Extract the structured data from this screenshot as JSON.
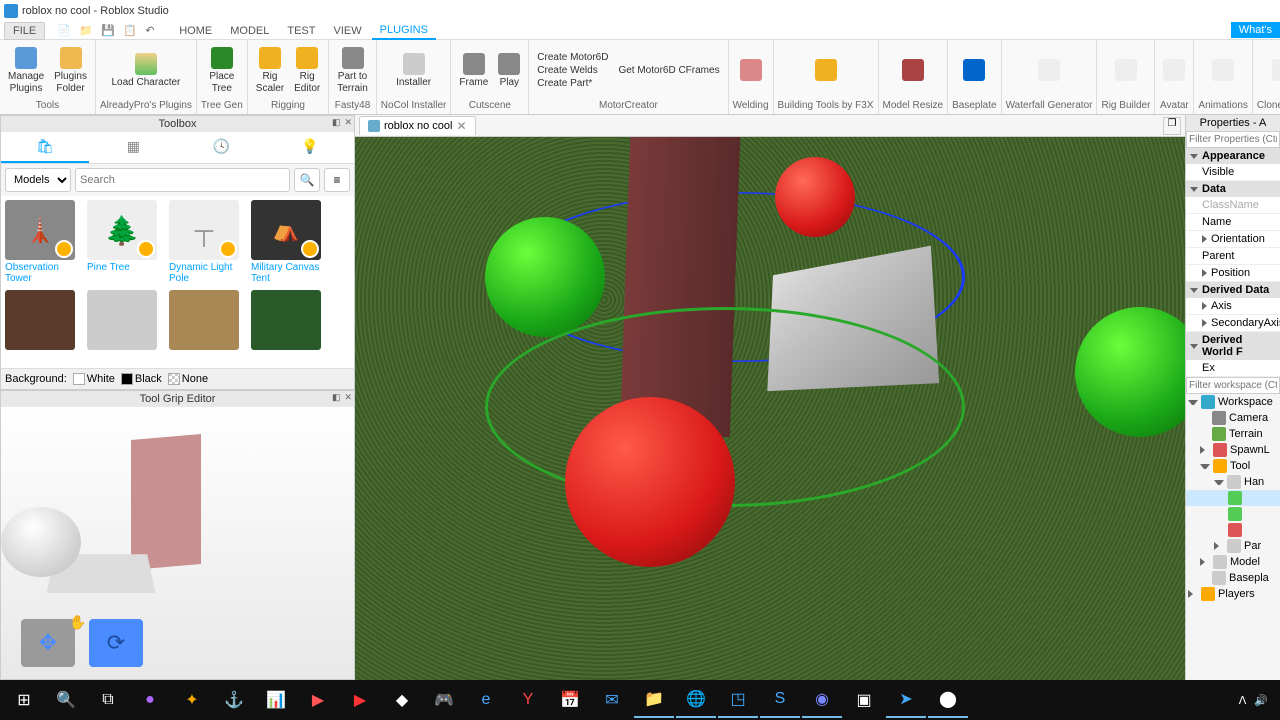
{
  "title": "roblox no cool - Roblox Studio",
  "whats_new": "What's",
  "menu": {
    "file": "FILE",
    "home": "HOME",
    "model": "MODEL",
    "test": "TEST",
    "view": "VIEW",
    "plugins": "PLUGINS"
  },
  "ribbon": {
    "groups": {
      "tools": "Tools",
      "alreadypro": "AlreadyPro's Plugins",
      "treegen": "Tree Gen",
      "rigging": "Rigging",
      "fasty48": "Fasty48",
      "nocol": "NoCol Installer",
      "cutscene": "Cutscene",
      "motor": "MotorCreator",
      "welding": "Welding",
      "bt": "Building Tools by F3X",
      "resize": "Model Resize",
      "baseplate": "Baseplate",
      "waterfall": "Waterfall Generator",
      "rigbuilder": "Rig Builder",
      "avatar": "Avatar",
      "animations": "Animations",
      "clonetroop": "CloneTroop"
    },
    "buttons": {
      "manage_plugins": "Manage\nPlugins",
      "plugins_folder": "Plugins\nFolder",
      "load_character": "Load\nCharacter",
      "place_tree": "Place\nTree",
      "rig_scaler": "Rig\nScaler",
      "rig_editor": "Rig\nEditor",
      "part_terrain": "Part to\nTerrain",
      "installer": "Installer",
      "frame": "Frame",
      "play": "Play"
    },
    "motor_links": {
      "create_motor": "Create Motor6D",
      "get_cframes": "Get Motor6D CFrames",
      "create_welds": "Create Welds",
      "create_part": "Create Part*"
    }
  },
  "toolbox": {
    "title": "Toolbox",
    "category": "Models",
    "search_placeholder": "Search",
    "assets": [
      {
        "name": "Observation Tower"
      },
      {
        "name": "Pine Tree"
      },
      {
        "name": "Dynamic Light Pole"
      },
      {
        "name": "Military Canvas Tent"
      }
    ],
    "background_label": "Background:",
    "bg_white": "White",
    "bg_black": "Black",
    "bg_none": "None"
  },
  "tool_grip": {
    "title": "Tool Grip Editor"
  },
  "viewport": {
    "tab": "roblox no cool"
  },
  "properties": {
    "title": "Properties - A",
    "filter_placeholder": "Filter Properties (Ctr",
    "sections": {
      "appearance": "Appearance",
      "data": "Data",
      "derived": "Derived Data",
      "derived_world": "Derived World F"
    },
    "rows": {
      "visible": "Visible",
      "classname": "ClassName",
      "name": "Name",
      "orientation": "Orientation",
      "parent": "Parent",
      "position": "Position",
      "axis": "Axis",
      "secondary": "SecondaryAxis",
      "ex": "Ex"
    }
  },
  "explorer": {
    "filter_placeholder": "Filter workspace (Ctr",
    "workspace": "Workspace",
    "camera": "Camera",
    "terrain": "Terrain",
    "spawn": "SpawnL",
    "tool": "Tool",
    "han": "Han",
    "par": "Par",
    "model": "Model",
    "baseplate": "Basepla",
    "players": "Players"
  }
}
